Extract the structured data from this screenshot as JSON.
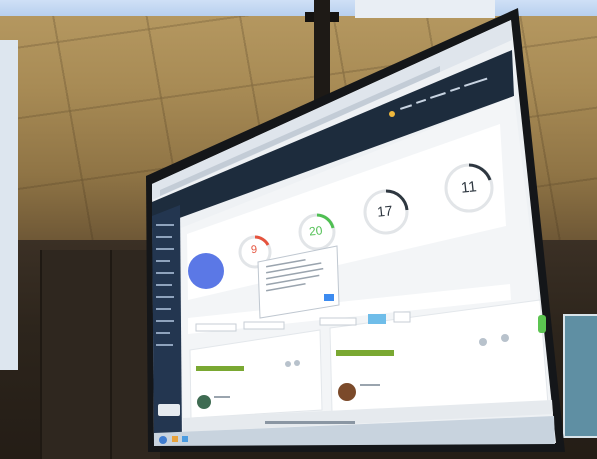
{
  "scene": {
    "colors": {
      "ceiling": "#a88b55",
      "wall": "#2d251c",
      "monitor_bezel": "#1a1c1f",
      "app_header": "#1d2c3d",
      "sidebar": "#233650",
      "accent_blue": "#5b78e6",
      "accent_green": "#5cc451",
      "ring_red": "#e5533d"
    }
  },
  "screen": {
    "stat_circles": [
      {
        "value": "9",
        "ring_color": "#e5533d"
      },
      {
        "value": "20",
        "ring_color": "#4fbf52"
      },
      {
        "value": "17",
        "ring_color": "#2e3740"
      },
      {
        "value": "11",
        "ring_color": "#2e3740"
      }
    ],
    "card_titles": [
      {
        "title": ""
      },
      {
        "title": ""
      }
    ]
  }
}
